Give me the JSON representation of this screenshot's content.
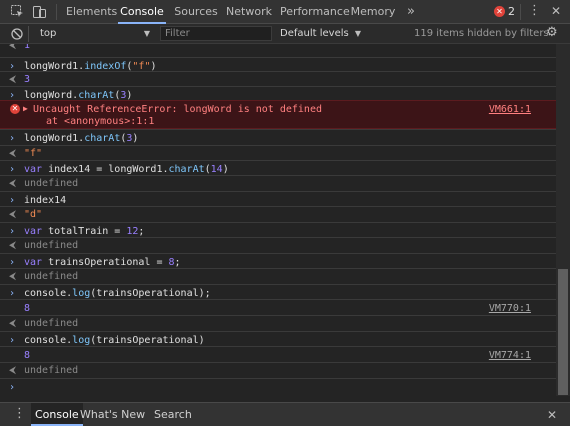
{
  "tabs": [
    "Elements",
    "Console",
    "Sources",
    "Network",
    "Performance",
    "Memory"
  ],
  "more_tabs_icon": "»",
  "error_count": "2",
  "toolbar": {
    "context": "top",
    "filter_placeholder": "Filter",
    "levels": "Default levels",
    "hidden_info": "119 items hidden by filters"
  },
  "console": [
    {
      "kind": "out",
      "text": "1"
    },
    {
      "kind": "in",
      "text": "longWord1.indexOf(\"f\")"
    },
    {
      "kind": "out",
      "text": "3"
    },
    {
      "kind": "in",
      "text": "longWord.charAt(3)"
    },
    {
      "kind": "error",
      "text": "Uncaught ReferenceError: longWord is not defined",
      "text2": "at <anonymous>:1:1",
      "source": "VM661:1"
    },
    {
      "kind": "in",
      "text": "longWord1.charAt(3)"
    },
    {
      "kind": "out",
      "text": "\"f\""
    },
    {
      "kind": "in",
      "text": "var index14 = longWord1.charAt(14)"
    },
    {
      "kind": "out",
      "text": "undefined"
    },
    {
      "kind": "in",
      "text": "index14"
    },
    {
      "kind": "out",
      "text": "\"d\""
    },
    {
      "kind": "in",
      "text": "var totalTrain = 12;"
    },
    {
      "kind": "out",
      "text": "undefined"
    },
    {
      "kind": "in",
      "text": "var trainsOperational = 8;"
    },
    {
      "kind": "out",
      "text": "undefined"
    },
    {
      "kind": "in",
      "text": "console.log(trainsOperational);"
    },
    {
      "kind": "log",
      "text": "8",
      "source": "VM770:1"
    },
    {
      "kind": "out",
      "text": "undefined"
    },
    {
      "kind": "in",
      "text": "console.log(trainsOperational)"
    },
    {
      "kind": "log",
      "text": "8",
      "source": "VM774:1"
    },
    {
      "kind": "out",
      "text": "undefined"
    }
  ],
  "drawer_tabs": [
    "Console",
    "What's New",
    "Search"
  ],
  "icons": {
    "inspect": "inspect-element-icon",
    "device": "device-toolbar-icon",
    "settings": "settings-gear-icon",
    "menu": "kebab-menu-icon",
    "close": "close-icon",
    "clear": "clear-console-icon",
    "error": "error-circle-icon"
  },
  "colors": {
    "active_tab_underline": "#8ab4f8",
    "error_bg": "#3c1417",
    "error_text": "#ff8080"
  }
}
